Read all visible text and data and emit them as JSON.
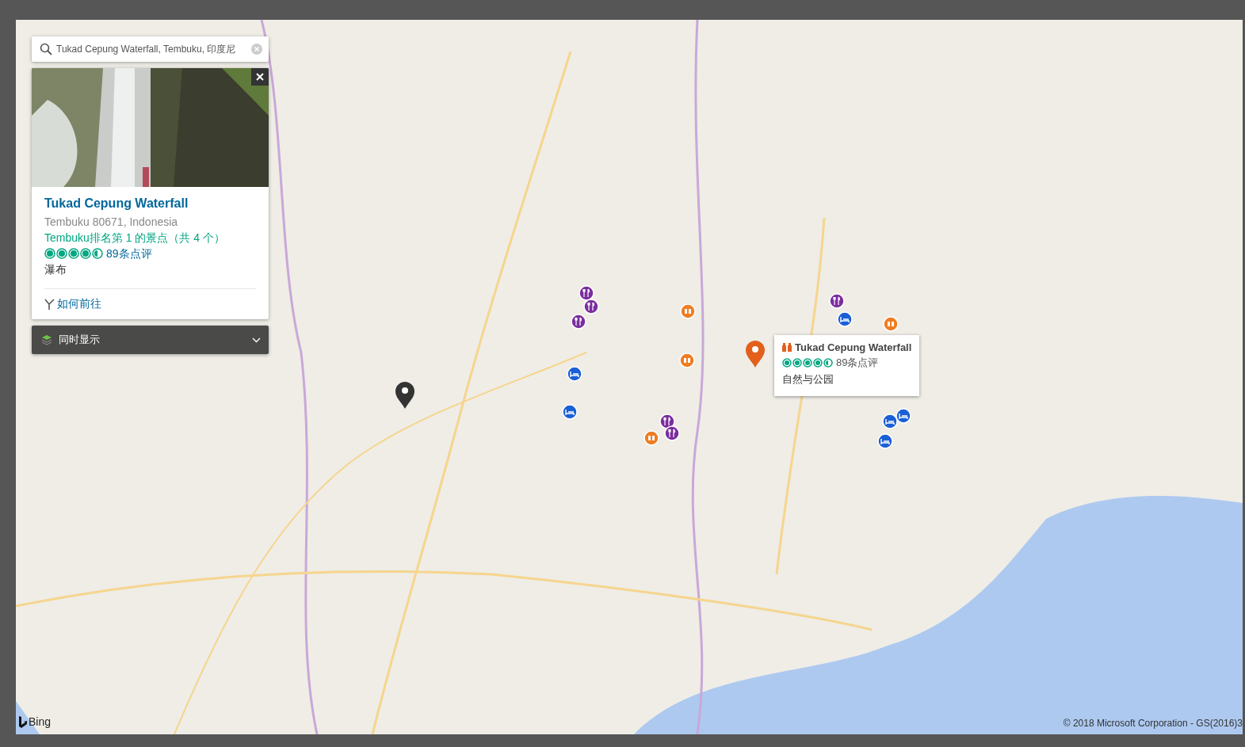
{
  "search": {
    "value": "Tukad Cepung Waterfall, Tembuku, 印度尼"
  },
  "card": {
    "title": "Tukad Cepung Waterfall",
    "address": "Tembuku 80671, Indonesia",
    "ranking": "Tembuku排名第 1 的景点（共 4 个）",
    "stars": 4.5,
    "reviews": "89条点评",
    "category": "瀑布",
    "directions": "如何前往"
  },
  "layers": {
    "label": "同时显示",
    "expanded": false
  },
  "popup": {
    "title": "Tukad Cepung Waterfall",
    "stars": 4.5,
    "reviews": "89条点评",
    "category": "自然与公园"
  },
  "markers": [
    {
      "kind": "selected"
    },
    {
      "kind": "pin"
    },
    {
      "kind": "restaurant"
    },
    {
      "kind": "restaurant"
    },
    {
      "kind": "restaurant"
    },
    {
      "kind": "restaurant"
    },
    {
      "kind": "restaurant"
    },
    {
      "kind": "restaurant"
    },
    {
      "kind": "hotel"
    },
    {
      "kind": "hotel"
    },
    {
      "kind": "hotel"
    },
    {
      "kind": "hotel"
    },
    {
      "kind": "hotel"
    },
    {
      "kind": "hotel"
    },
    {
      "kind": "attraction"
    },
    {
      "kind": "attraction"
    },
    {
      "kind": "attraction"
    },
    {
      "kind": "attraction"
    }
  ],
  "attribution": {
    "brand": "Bing",
    "copyright": "© 2018 Microsoft Corporation - GS(2016)3"
  }
}
